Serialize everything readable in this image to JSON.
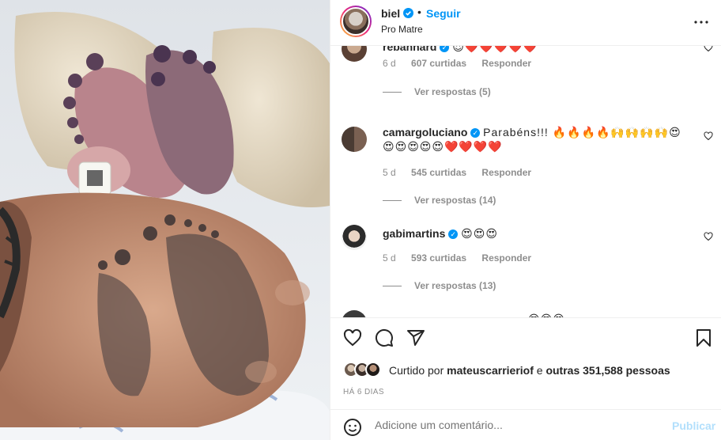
{
  "header": {
    "username": "biel",
    "separator": "•",
    "follow_label": "Seguir",
    "location": "Pro Matre",
    "more_label": "•••"
  },
  "comments": [
    {
      "username": "rebahnard",
      "text": "😍❤️❤️❤️❤️❤️",
      "time": "6 d",
      "likes": "607 curtidas",
      "reply_label": "Responder",
      "view_replies": "Ver respostas (5)"
    },
    {
      "username": "camargoluciano",
      "text": "Parabéns!!! 🔥🔥🔥🔥🙌🙌🙌🙌😍😍😍😍😍😍❤️❤️❤️❤️",
      "time": "5 d",
      "likes": "545 curtidas",
      "reply_label": "Responder",
      "view_replies": "Ver respostas (14)"
    },
    {
      "username": "gabimartins",
      "text": "😍😍😍",
      "time": "5 d",
      "likes": "593 curtidas",
      "reply_label": "Responder",
      "view_replies": "Ver respostas (13)"
    },
    {
      "username": "",
      "text": "😍😍😍"
    }
  ],
  "likes": {
    "prefix": "Curtido por ",
    "user": "mateuscarrieriof",
    "middle": " e ",
    "others": "outras 351,588 pessoas"
  },
  "timestamp": "HÁ 6 DIAS",
  "add_comment": {
    "placeholder": "Adicione um comentário...",
    "publish_label": "Publicar"
  },
  "icons": [
    "heart-icon",
    "comment-icon",
    "share-icon",
    "bookmark-icon",
    "more-icon",
    "emoji-icon",
    "verified-icon"
  ],
  "colors": {
    "accent": "#0095f6",
    "publish_disabled": "#b2dffc",
    "muted": "#8e8e8e"
  }
}
